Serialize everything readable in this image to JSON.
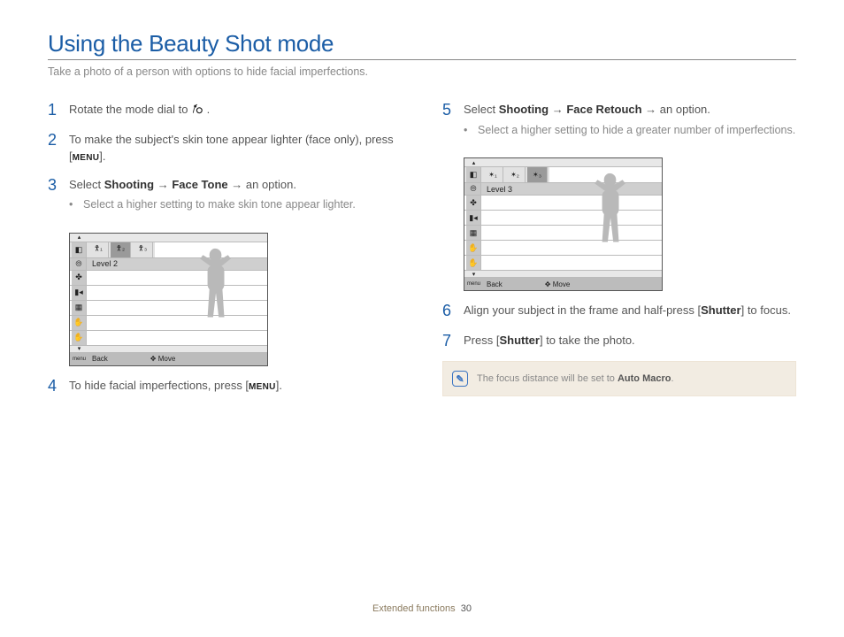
{
  "title": "Using the Beauty Shot mode",
  "subtitle": "Take a photo of a person with options to hide facial imperfections.",
  "steps": {
    "s1_pre": "Rotate the mode dial to ",
    "s1_post": ".",
    "s2_a": "To make the subject's skin tone appear lighter (face only), press [",
    "s2_menu": "MENU",
    "s2_b": "].",
    "s3_a": "Select ",
    "s3_shooting": "Shooting",
    "s3_arrow": " → ",
    "s3_facetone": "Face Tone",
    "s3_b": " → an option.",
    "s3_bullet": "Select a higher setting to make skin tone appear lighter.",
    "s4_a": "To hide facial imperfections, press [",
    "s4_menu": "MENU",
    "s4_b": "].",
    "s5_a": "Select ",
    "s5_shooting": "Shooting",
    "s5_arrow": " → ",
    "s5_faceretouch": "Face Retouch",
    "s5_b": " → an option.",
    "s5_bullet": "Select a higher setting to hide a greater number of imperfections.",
    "s6_a": "Align your subject in the frame and half-press [",
    "s6_shutter": "Shutter",
    "s6_b": "] to focus.",
    "s7_a": "Press [",
    "s7_shutter": "Shutter",
    "s7_b": "] to take the photo."
  },
  "shot1": {
    "level_label": "Level 2",
    "back": "Back",
    "move": "Move"
  },
  "shot2": {
    "level_label": "Level 3",
    "back": "Back",
    "move": "Move"
  },
  "note": {
    "pre": "The focus distance will be set to ",
    "b": "Auto Macro",
    "post": "."
  },
  "footer": {
    "section": "Extended functions",
    "page": "30"
  }
}
